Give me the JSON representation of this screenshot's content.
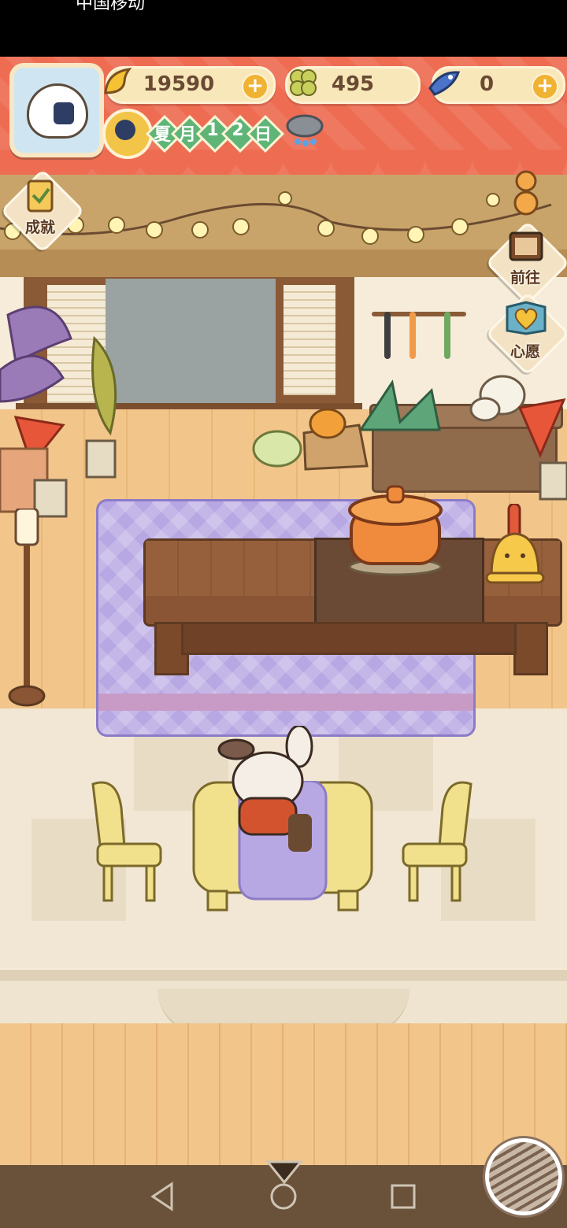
{
  "status_bar": {
    "text": "中国移动"
  },
  "currencies": {
    "banana": {
      "icon": "banana-icon",
      "value": "19590"
    },
    "clover": {
      "icon": "clover-icon",
      "value": "495"
    },
    "gem_fish": {
      "icon": "fish-gem-icon",
      "value": "0"
    },
    "plus": "+"
  },
  "calendar": {
    "season": "夏",
    "month_label": "月",
    "day_digits": [
      "1",
      "2"
    ],
    "day_label": "日",
    "weather": "rain-cloud-icon"
  },
  "side_buttons": {
    "achievement": "成就",
    "goto": "前往",
    "wish": "心愿"
  },
  "colors": {
    "banner": "#ee6d52",
    "rug": "#b7a7e3",
    "counter": "#8a5534",
    "diamond": "#5fb576"
  }
}
